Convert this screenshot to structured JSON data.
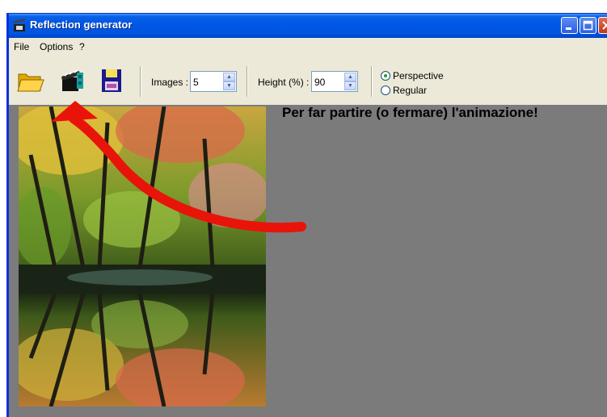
{
  "window": {
    "title": "Reflection generator",
    "titlebar_buttons": [
      "minimize-icon",
      "maximize-icon",
      "close-icon"
    ]
  },
  "menu": {
    "items": [
      "File",
      "Options",
      "?"
    ]
  },
  "toolbar": {
    "icons": [
      "open-folder-icon",
      "animate-icon",
      "save-disk-icon"
    ],
    "images_label": "Images :",
    "images_value": "5",
    "height_label": "Height (%) :",
    "height_value": "90",
    "mode_options": [
      {
        "label": "Perspective",
        "selected": true
      },
      {
        "label": "Regular",
        "selected": false
      }
    ]
  },
  "annotation": {
    "text": "Per far partire (o fermare) l'animazione!",
    "arrow_color": "#e8140a"
  },
  "colors": {
    "titlebar": "#0058e6",
    "workspace": "#7b7b7b",
    "window_bg": "#ece9d8"
  }
}
